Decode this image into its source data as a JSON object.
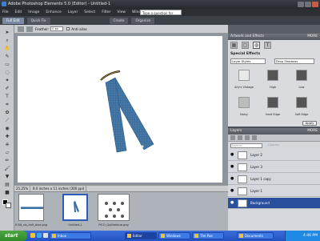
{
  "window": {
    "title": "Adobe Photoshop Elements 5.0 (Editor) - Untitled-1"
  },
  "menu": {
    "items": [
      "File",
      "Edit",
      "Image",
      "Enhance",
      "Layer",
      "Select",
      "Filter",
      "View",
      "Window",
      "Help"
    ],
    "help_search": "Type a question for help"
  },
  "modes": {
    "full_edit": "Full Edit",
    "quick_fix": "Quick Fix",
    "create": "Create",
    "organize": "Organize"
  },
  "options": {
    "feather_label": "Feather:",
    "feather_value": "0 px",
    "antialias_label": "Anti-alias"
  },
  "status": {
    "zoom": "25.25%",
    "doc_info": "8.0 inches x 11 inches (300 ppi)"
  },
  "photo_bin": {
    "items": [
      {
        "label": "8 Bit_xls_half_blue.png"
      },
      {
        "label": "Untitled-1"
      },
      {
        "label": "PICO_Quilterblue.png"
      }
    ]
  },
  "effects_panel": {
    "title": "Artwork and Effects",
    "more": "MORE",
    "section": "Special Effects",
    "category": "Layer Styles",
    "style_set": "Drop Shadows",
    "styles": [
      "Ally's Vintage",
      "High",
      "Low",
      "Noisy",
      "Hard Edge",
      "Soft Edge"
    ],
    "apply": "Apply"
  },
  "layers_panel": {
    "title": "Layers",
    "more": "MORE",
    "mode": "Normal",
    "opacity_label": "Opacity:",
    "layers": [
      "Layer 2",
      "Layer 3",
      "Layer 1 copy",
      "Layer 1",
      "Background"
    ]
  },
  "taskbar": {
    "start": "start",
    "tasks": [
      "Inbox",
      "Editor",
      "Windows",
      "The Poe",
      "Documents"
    ],
    "clock": "4:46 PM"
  },
  "colors": {
    "accent": "#2a4f9d",
    "tape": "#3a6fa3"
  }
}
